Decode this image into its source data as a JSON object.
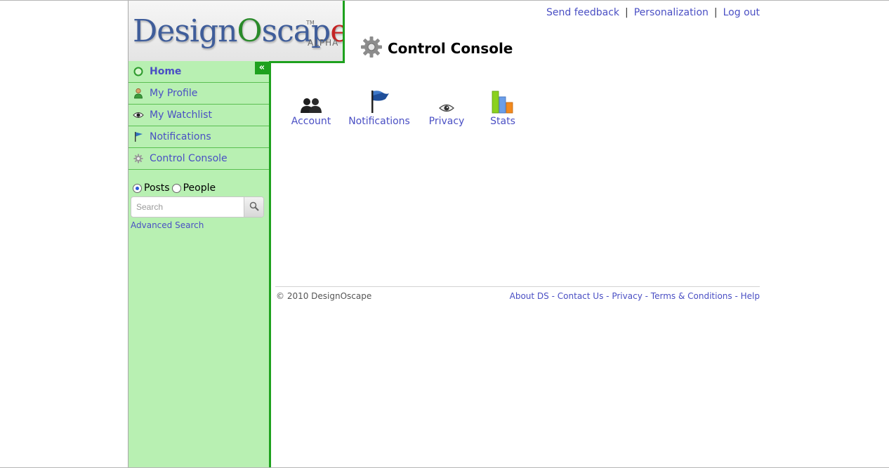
{
  "logo": {
    "text_part1": "Design",
    "text_o": "O",
    "text_part2": "scap",
    "text_e": "e",
    "tm": "TM",
    "tag": "ALPHA"
  },
  "header": {
    "links": [
      "Send feedback",
      "Personalization",
      "Log out"
    ],
    "separator": "|",
    "title": "Control Console",
    "title_icon": "gear-icon"
  },
  "sidebar": {
    "collapse_label": "«",
    "items": [
      {
        "label": "Home",
        "icon": "home-ring-icon",
        "active": true
      },
      {
        "label": "My Profile",
        "icon": "person-icon",
        "active": false
      },
      {
        "label": "My Watchlist",
        "icon": "eye-icon",
        "active": false
      },
      {
        "label": "Notifications",
        "icon": "flag-icon",
        "active": false
      },
      {
        "label": "Control Console",
        "icon": "gear-icon",
        "active": false
      }
    ],
    "search": {
      "options": [
        "Posts",
        "People"
      ],
      "selected": "Posts",
      "placeholder": "Search",
      "value": "",
      "advanced_label": "Advanced Search"
    }
  },
  "console": {
    "items": [
      {
        "label": "Account",
        "icon": "users-icon"
      },
      {
        "label": "Notifications",
        "icon": "flag-icon"
      },
      {
        "label": "Privacy",
        "icon": "eye-icon"
      },
      {
        "label": "Stats",
        "icon": "bar-chart-icon"
      }
    ]
  },
  "footer": {
    "copyright": "© 2010 DesignOscape",
    "links": [
      "About DS",
      "Contact Us",
      "Privacy",
      "Terms & Conditions",
      "Help"
    ],
    "separator": "-"
  },
  "colors": {
    "accent_green": "#1ea11e",
    "sidebar_bg": "#b8f0b2",
    "link": "#4a4fc4"
  }
}
